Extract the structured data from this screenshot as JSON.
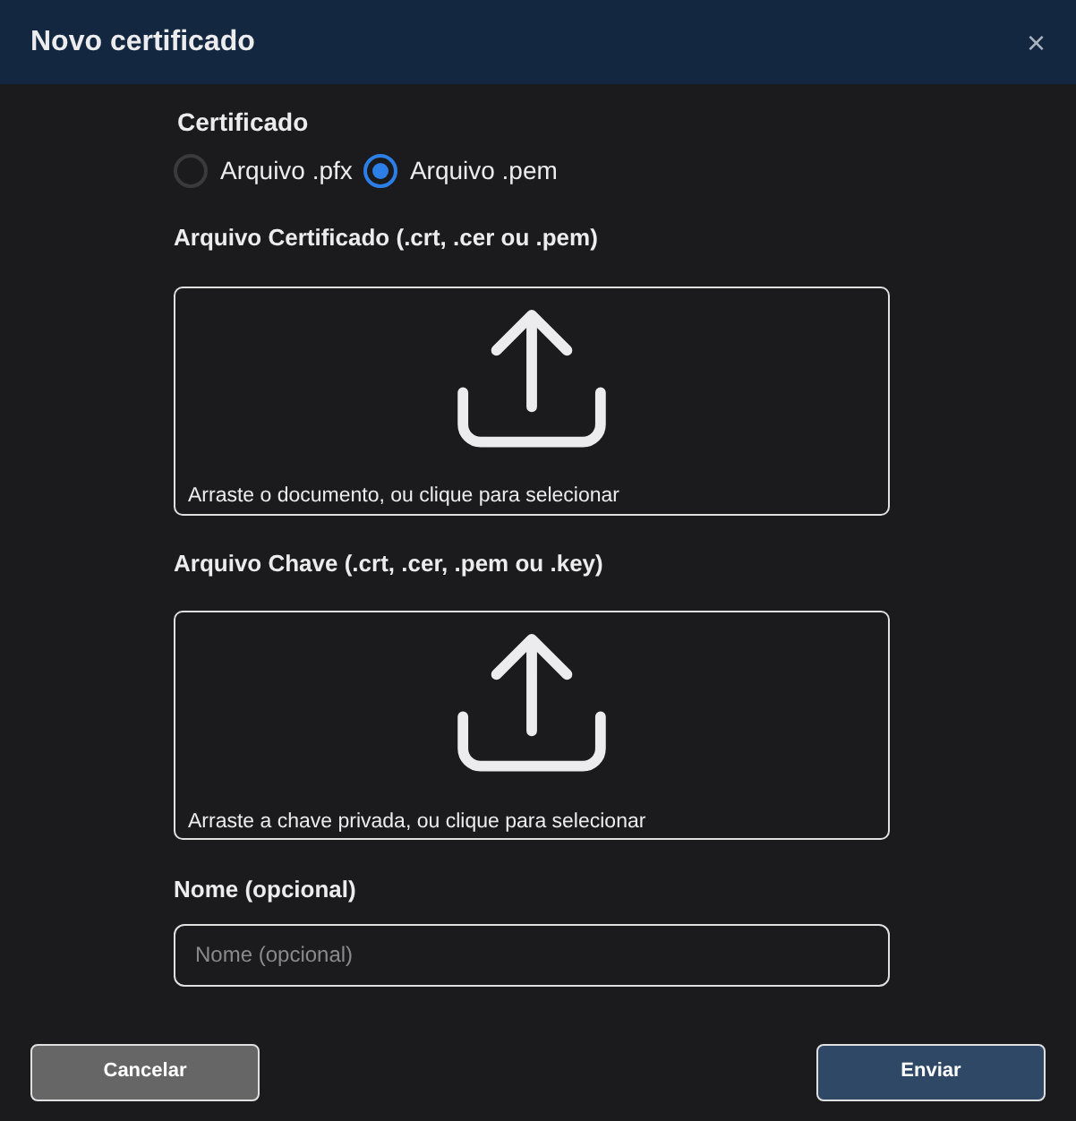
{
  "dialog": {
    "title": "Novo certificado",
    "close": "×"
  },
  "certificate_type": {
    "label": "Certificado",
    "options": [
      {
        "label": "Arquivo .pfx",
        "selected": false
      },
      {
        "label": "Arquivo .pem",
        "selected": true
      }
    ]
  },
  "dropzones": [
    {
      "label": "Arquivo Certificado (.crt, .cer ou .pem)",
      "hint": "Arraste o documento, ou clique para selecionar"
    },
    {
      "label": "Arquivo Chave (.crt, .cer, .pem ou .key)",
      "hint": "Arraste a chave privada, ou clique para selecionar"
    }
  ],
  "name_field": {
    "label": "Nome (opcional)",
    "placeholder": "Nome (opcional)"
  },
  "buttons": [
    {
      "label": "Cancelar",
      "kind": "secondary"
    },
    {
      "label": "Enviar",
      "kind": "primary"
    }
  ]
}
